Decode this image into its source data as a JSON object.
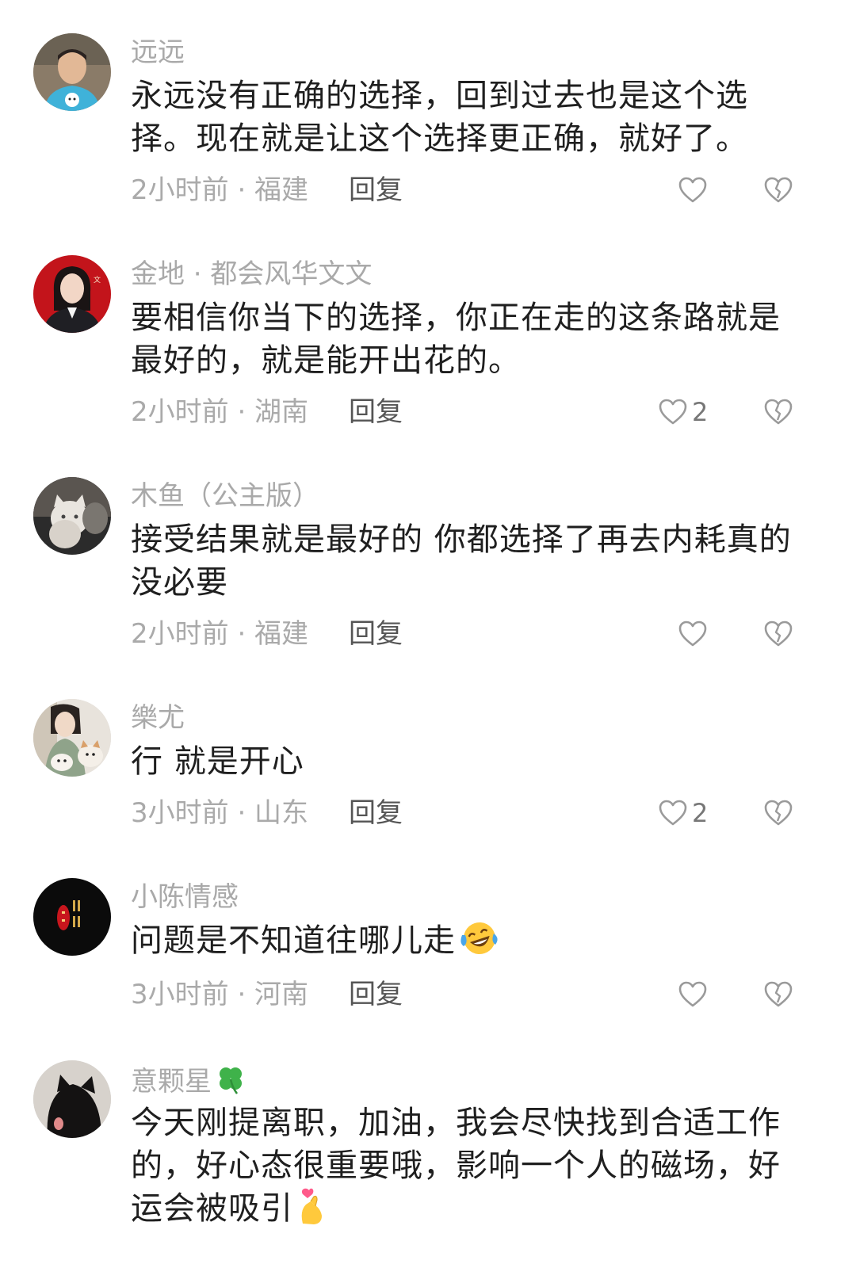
{
  "comments": [
    {
      "username": "远远",
      "text": "永远没有正确的选择，回到过去也是这个选择。现在就是让这个选择更正确，就好了。",
      "meta": "2小时前 · 福建",
      "reply_label": "回复",
      "like_count": "",
      "avatar_icon": "person-blue-shirt-avatar"
    },
    {
      "username": "金地 · 都会风华文文",
      "text": "要相信你当下的选择，你正在走的这条路就是最好的，就是能开出花的。",
      "meta": "2小时前 · 湖南",
      "reply_label": "回复",
      "like_count": "2",
      "avatar_icon": "woman-red-background-avatar"
    },
    {
      "username": "木鱼（公主版）",
      "text": "接受结果就是最好的 你都选择了再去内耗真的没必要",
      "meta": "2小时前 · 福建",
      "reply_label": "回复",
      "like_count": "",
      "avatar_icon": "white-cat-avatar"
    },
    {
      "username": "樂尤",
      "text": "行 就是开心",
      "meta": "3小时前 · 山东",
      "reply_label": "回复",
      "like_count": "2",
      "avatar_icon": "woman-with-dogs-avatar"
    },
    {
      "username": "小陈情感",
      "text": "问题是不知道往哪儿走",
      "text_emoji": "laughing-tears-emoji",
      "meta": "3小时前 · 河南",
      "reply_label": "回复",
      "like_count": "",
      "avatar_icon": "black-red-logo-avatar"
    },
    {
      "username": "意颗星",
      "username_emoji": "four-leaf-clover-emoji",
      "text": "今天刚提离职，加油，我会尽快找到合适工作的，好心态很重要哦，影响一个人的磁场，好运会被吸引",
      "text_emoji": "finger-heart-emoji",
      "meta": "",
      "reply_label": "",
      "like_count": "",
      "avatar_icon": "black-cat-avatar"
    }
  ],
  "colors": {
    "username": "#a9a9a9",
    "body_text": "#1f1f1f",
    "meta": "#aaaaaa",
    "reply": "#555555",
    "icon_stroke": "#9a9a9a"
  }
}
